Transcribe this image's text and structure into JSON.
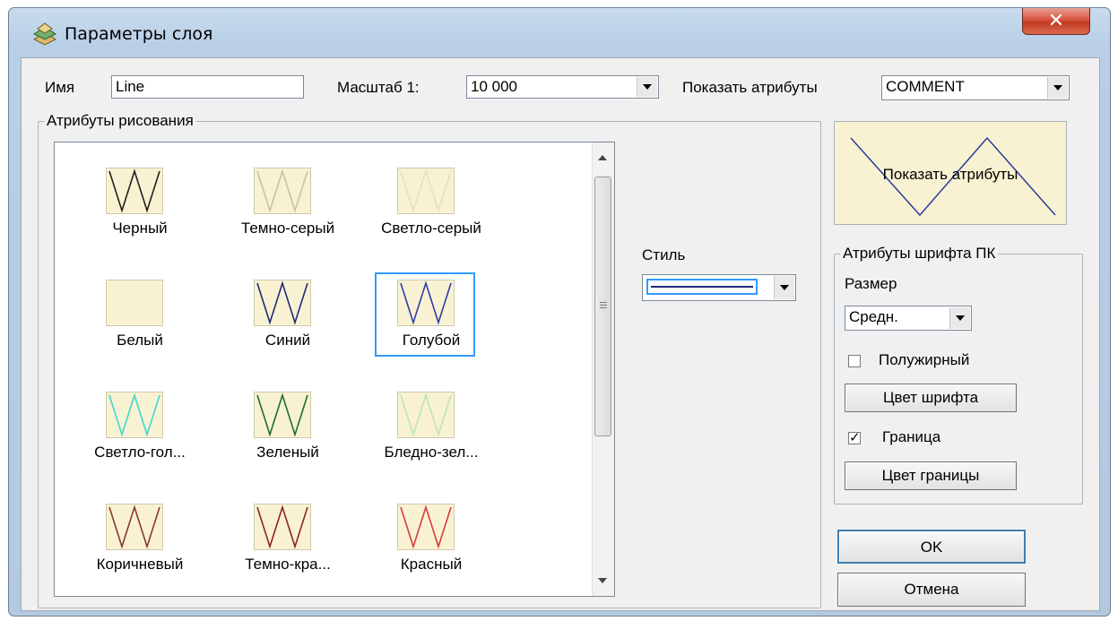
{
  "window": {
    "title": "Параметры слоя",
    "close_glyph": "✕"
  },
  "name_field": {
    "label": "Имя",
    "value": "Line"
  },
  "scale": {
    "label": "Масштаб 1:",
    "value": "10 000"
  },
  "show_attrs": {
    "label": "Показать атрибуты",
    "value": "COMMENT"
  },
  "drawing_group": {
    "title": "Атрибуты рисования",
    "items": [
      {
        "label": "Черный",
        "color": "#202020"
      },
      {
        "label": "Темно-серый",
        "color": "#c8c2a8"
      },
      {
        "label": "Светло-серый",
        "color": "#e4dfc6"
      },
      {
        "label": "Белый",
        "color": "#f8f2d2"
      },
      {
        "label": "Синий",
        "color": "#1e2a78"
      },
      {
        "label": "Голубой",
        "color": "#2e3ca8"
      },
      {
        "label": "Светло-гол...",
        "color": "#3cd8d0"
      },
      {
        "label": "Зеленый",
        "color": "#1e6e2a"
      },
      {
        "label": "Бледно-зел...",
        "color": "#bfe6ad"
      },
      {
        "label": "Коричневый",
        "color": "#8a3a26"
      },
      {
        "label": "Темно-кра...",
        "color": "#8e2222"
      },
      {
        "label": "Красный",
        "color": "#d83a3a"
      }
    ],
    "selected_index": 5
  },
  "style": {
    "label": "Стиль"
  },
  "preview": {
    "text": "Показать атрибуты",
    "line_color": "#2b3b9c"
  },
  "font_group": {
    "title": "Атрибуты шрифта ПК",
    "size_label": "Размер",
    "size_value": "Средн.",
    "bold_label": "Полужирный",
    "bold_checked": "",
    "font_color_button": "Цвет шрифта",
    "border_label": "Граница",
    "border_checked": "✓",
    "border_color_button": "Цвет границы"
  },
  "buttons": {
    "ok": "OK",
    "cancel": "Отмена"
  }
}
